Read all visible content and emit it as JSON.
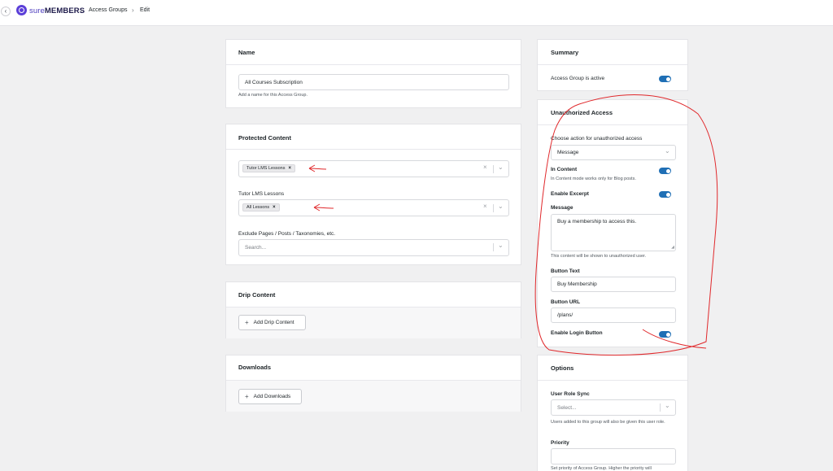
{
  "header": {
    "back_icon": "chevron-left-icon",
    "logo_prefix": "sure",
    "logo_name": "MEMBERS",
    "breadcrumbs": [
      "Access Groups",
      "Edit"
    ]
  },
  "name_card": {
    "title": "Name",
    "value": "All Courses Subscription",
    "help": "Add a name for this Access Group."
  },
  "protected_content": {
    "title": "Protected Content",
    "tag1": "Tutor LMS Lessons",
    "sublabel": "Tutor LMS Lessons",
    "tag2": "All Lessons",
    "exclude_label": "Exclude Pages / Posts / Taxonomies, etc.",
    "exclude_placeholder": "Search..."
  },
  "drip": {
    "title": "Drip Content",
    "button": "Add Drip Content"
  },
  "downloads": {
    "title": "Downloads",
    "button": "Add Downloads"
  },
  "summary": {
    "title": "Summary",
    "active_label": "Access Group is active"
  },
  "unauthorized": {
    "title": "Unauthorized Access",
    "action_label": "Choose action for unauthorized access",
    "action_value": "Message",
    "in_content_label": "In Content",
    "in_content_help": "In Content mode works only for Blog posts.",
    "excerpt_label": "Enable Excerpt",
    "message_label": "Message",
    "message_value": "Buy a membership to access this.",
    "message_help": "This content will be shown to unauthorized user.",
    "button_text_label": "Button Text",
    "button_text_value": "Buy Membership",
    "button_url_label": "Button URL",
    "button_url_value": "/plans/",
    "login_label": "Enable Login Button"
  },
  "options": {
    "title": "Options",
    "role_sync_label": "User Role Sync",
    "role_sync_placeholder": "Select...",
    "role_sync_help": "Users added to this group will also be given this user role.",
    "priority_label": "Priority",
    "priority_help": "Set priority of Access Group. Higher the priority will"
  },
  "colors": {
    "accent": "#1f6fb5",
    "brand": "#5b3fd8",
    "annotation": "#e0282b"
  }
}
